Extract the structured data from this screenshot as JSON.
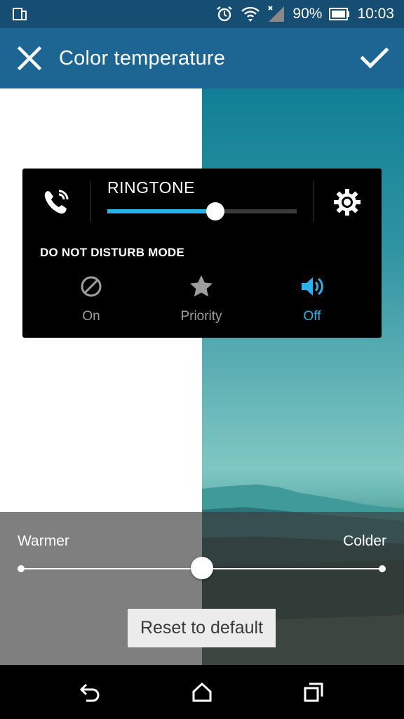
{
  "status_bar": {
    "battery": "90%",
    "time": "10:03",
    "icons": [
      "screen-mirror-icon",
      "alarm-icon",
      "wifi-icon",
      "cell-signal-icon",
      "battery-icon"
    ]
  },
  "app_bar": {
    "title": "Color temperature",
    "close_icon": "close-icon",
    "confirm_icon": "check-icon"
  },
  "volume_panel": {
    "ringtone_label": "RINGTONE",
    "ringtone_level": 0.57,
    "dnd_label": "DO NOT DISTURB MODE",
    "dnd_options": [
      {
        "label": "On",
        "icon": "block-icon",
        "active": false
      },
      {
        "label": "Priority",
        "icon": "star-icon",
        "active": false
      },
      {
        "label": "Off",
        "icon": "speaker-icon",
        "active": true
      }
    ],
    "active_color": "#27b4ea"
  },
  "temperature": {
    "warmer_label": "Warmer",
    "colder_label": "Colder",
    "level": 0.5,
    "reset_label": "Reset to default"
  },
  "nav_bar": {
    "icons": [
      "back-icon",
      "home-icon",
      "recents-icon"
    ]
  }
}
